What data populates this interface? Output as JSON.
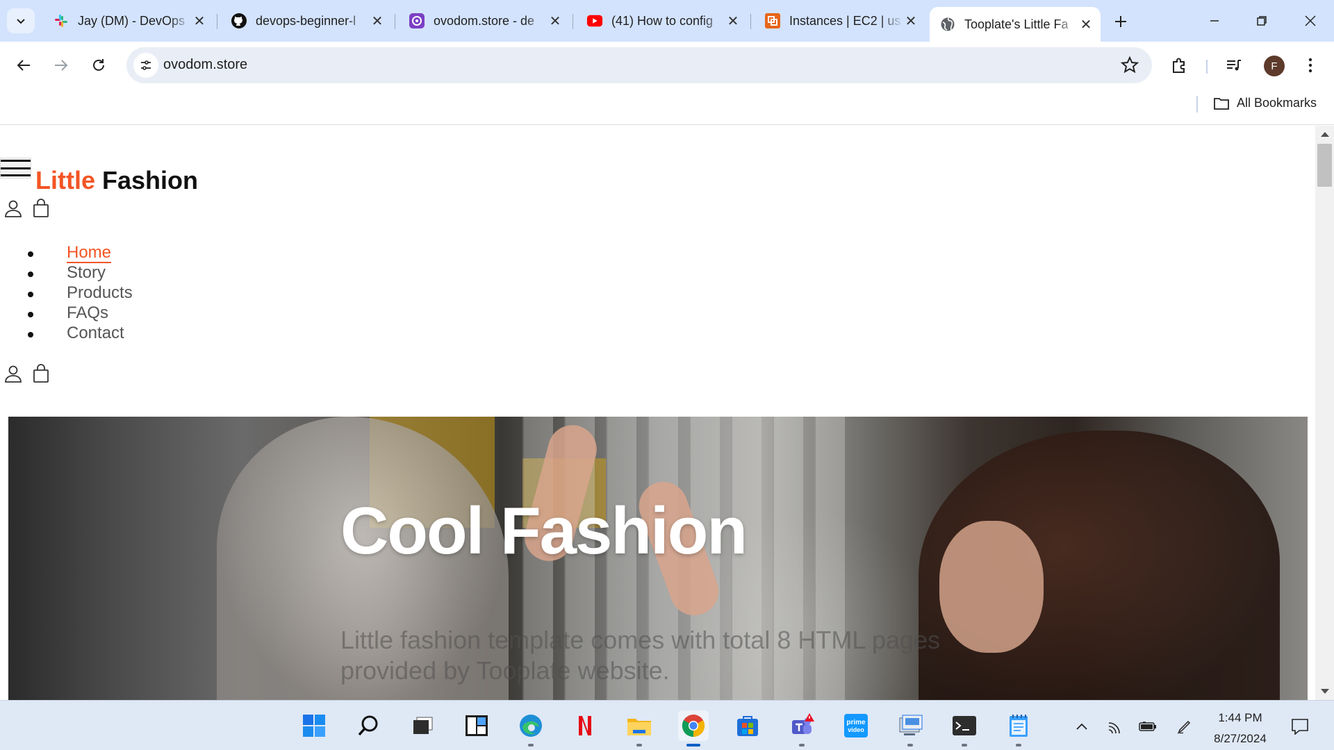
{
  "tabs": [
    {
      "title": "Jay (DM) - DevOps",
      "icon": "slack-icon"
    },
    {
      "title": "devops-beginner-l",
      "icon": "github-icon"
    },
    {
      "title": "ovodom.store - de",
      "icon": "extension-icon"
    },
    {
      "title": "(41) How to config",
      "icon": "youtube-icon"
    },
    {
      "title": "Instances | EC2 | us",
      "icon": "aws-icon"
    },
    {
      "title": "Tooplate's Little Fa",
      "icon": "globe-icon",
      "active": true
    }
  ],
  "address_bar": {
    "url": "ovodom.store"
  },
  "profile": {
    "initial": "F"
  },
  "bookmarks": {
    "all_label": "All Bookmarks"
  },
  "site": {
    "brand_accent": "Little",
    "brand_rest": "Fashion",
    "menu": [
      "Home",
      "Story",
      "Products",
      "FAQs",
      "Contact"
    ],
    "active_menu": "Home",
    "hero": {
      "title": "Cool Fashion",
      "text_line1": "Little fashion template comes with total 8 HTML pages",
      "text_line2": "provided by Tooplate website."
    }
  },
  "taskbar": {
    "apps": [
      "windows-start-icon",
      "search-icon",
      "task-view-icon",
      "widgets-icon",
      "edge-icon",
      "netflix-icon",
      "file-explorer-icon",
      "chrome-icon",
      "store-icon",
      "teams-icon",
      "prime-video-icon",
      "remote-desktop-icon",
      "terminal-icon",
      "notepad-icon"
    ],
    "time": "1:44 PM",
    "date": "8/27/2024"
  },
  "colors": {
    "accent": "#f35525",
    "tabstrip": "#d3e3fd",
    "omnibox": "#e9eef6"
  }
}
